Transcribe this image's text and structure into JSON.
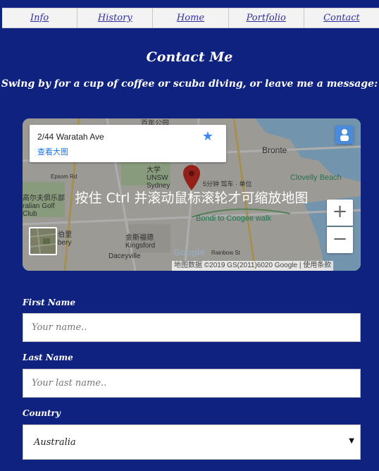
{
  "nav": {
    "items": [
      "Info",
      "History",
      "Home",
      "Portfolio",
      "Contact"
    ]
  },
  "page": {
    "title": "Contact Me",
    "subtitle": "Swing by for a cup of coffee or scuba diving, or leave me a message:"
  },
  "map": {
    "address": "2/44 Waratah Ave",
    "view_larger": "查看大图",
    "overlay_hint": "按住 Ctrl 并滚动鼠标滚轮才可缩放地图",
    "zoom_in": "+",
    "zoom_out": "−",
    "attribution": "地图数据 ©2019 GS(2011)6020 Google | 使用条款",
    "google_logo": "Google",
    "labels": {
      "bronte": "Bronte",
      "clovelly": "Clovelly Beach",
      "unsw": "大学 UNSW Sydney",
      "kingsford": "金斯福德 Kingsford",
      "daceyville": "Daceyville",
      "walk": "Bondi to Coogee walk",
      "golf": "高尔夫俱乐部 ralian Golf Club",
      "park": "百年公园",
      "bery": "伯里 bery",
      "epsom": "Epsom Rd",
      "rainbow": "Rainbow St",
      "drive": "5分钟 驾车 · 单位"
    },
    "colors": {
      "water": "#aadaff",
      "land": "#e8e6df",
      "pin": "#d93025"
    }
  },
  "form": {
    "first_name_label": "First Name",
    "first_name_placeholder": "Your name..",
    "last_name_label": "Last Name",
    "last_name_placeholder": "Your last name..",
    "country_label": "Country",
    "country_value": "Australia",
    "country_arrow": "▼"
  }
}
